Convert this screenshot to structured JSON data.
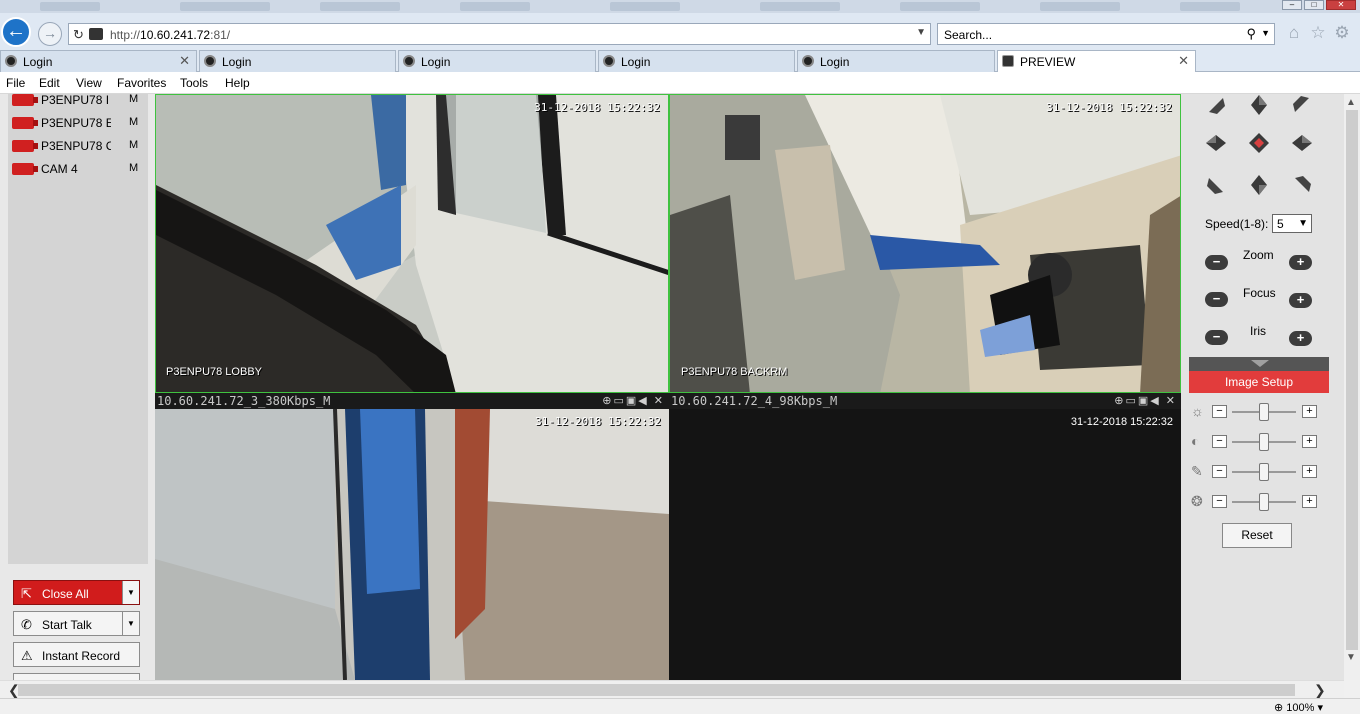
{
  "browser": {
    "url_prefix": "http://",
    "url_host": "10.60.241.72",
    "url_suffix": ":81/",
    "search_placeholder": "Search...",
    "tabs": [
      {
        "label": "Login",
        "active": false
      },
      {
        "label": "Login",
        "active": false
      },
      {
        "label": "Login",
        "active": false
      },
      {
        "label": "Login",
        "active": false
      },
      {
        "label": "Login",
        "active": false
      },
      {
        "label": "PREVIEW",
        "active": true
      }
    ],
    "menu": [
      "File",
      "Edit",
      "View",
      "Favorites",
      "Tools",
      "Help"
    ],
    "zoom": "100%"
  },
  "camera_list": [
    {
      "label": "P3ENPU78 I",
      "flag": "M"
    },
    {
      "label": "P3ENPU78 E",
      "flag": "M"
    },
    {
      "label": "P3ENPU78 C",
      "flag": "M"
    },
    {
      "label": "CAM 4",
      "flag": "M"
    }
  ],
  "controls": {
    "close_all": "Close All",
    "start_talk": "Start Talk",
    "instant_record": "Instant Record"
  },
  "views": {
    "v1": {
      "time": "31-12-2018 15:22:32",
      "name": "P3ENPU78 LOBBY"
    },
    "v2": {
      "time": "31-12-2018 15:22:32",
      "name": "P3ENPU78 BACKRM",
      "status": "10.60.241.72_3_380Kbps_M"
    },
    "v3": {
      "time": "31-12-2018 15:22:32",
      "status": "10.60.241.72_4_98Kbps_M"
    },
    "v4": {
      "time": "31-12-2018 15:22:32"
    }
  },
  "ptz": {
    "speed_label": "Speed(1-8):",
    "speed_value": "5",
    "zoom_label": "Zoom",
    "focus_label": "Focus",
    "iris_label": "Iris",
    "image_setup": "Image Setup",
    "reset": "Reset",
    "sliders": [
      {
        "name": "brightness-icon",
        "value": 0.5
      },
      {
        "name": "contrast-icon",
        "value": 0.5
      },
      {
        "name": "saturation-icon",
        "value": 0.5
      },
      {
        "name": "hue-icon",
        "value": 0.5
      }
    ]
  },
  "colors": {
    "accent_red": "#e23c3c",
    "selected_border": "#3fc23f"
  }
}
